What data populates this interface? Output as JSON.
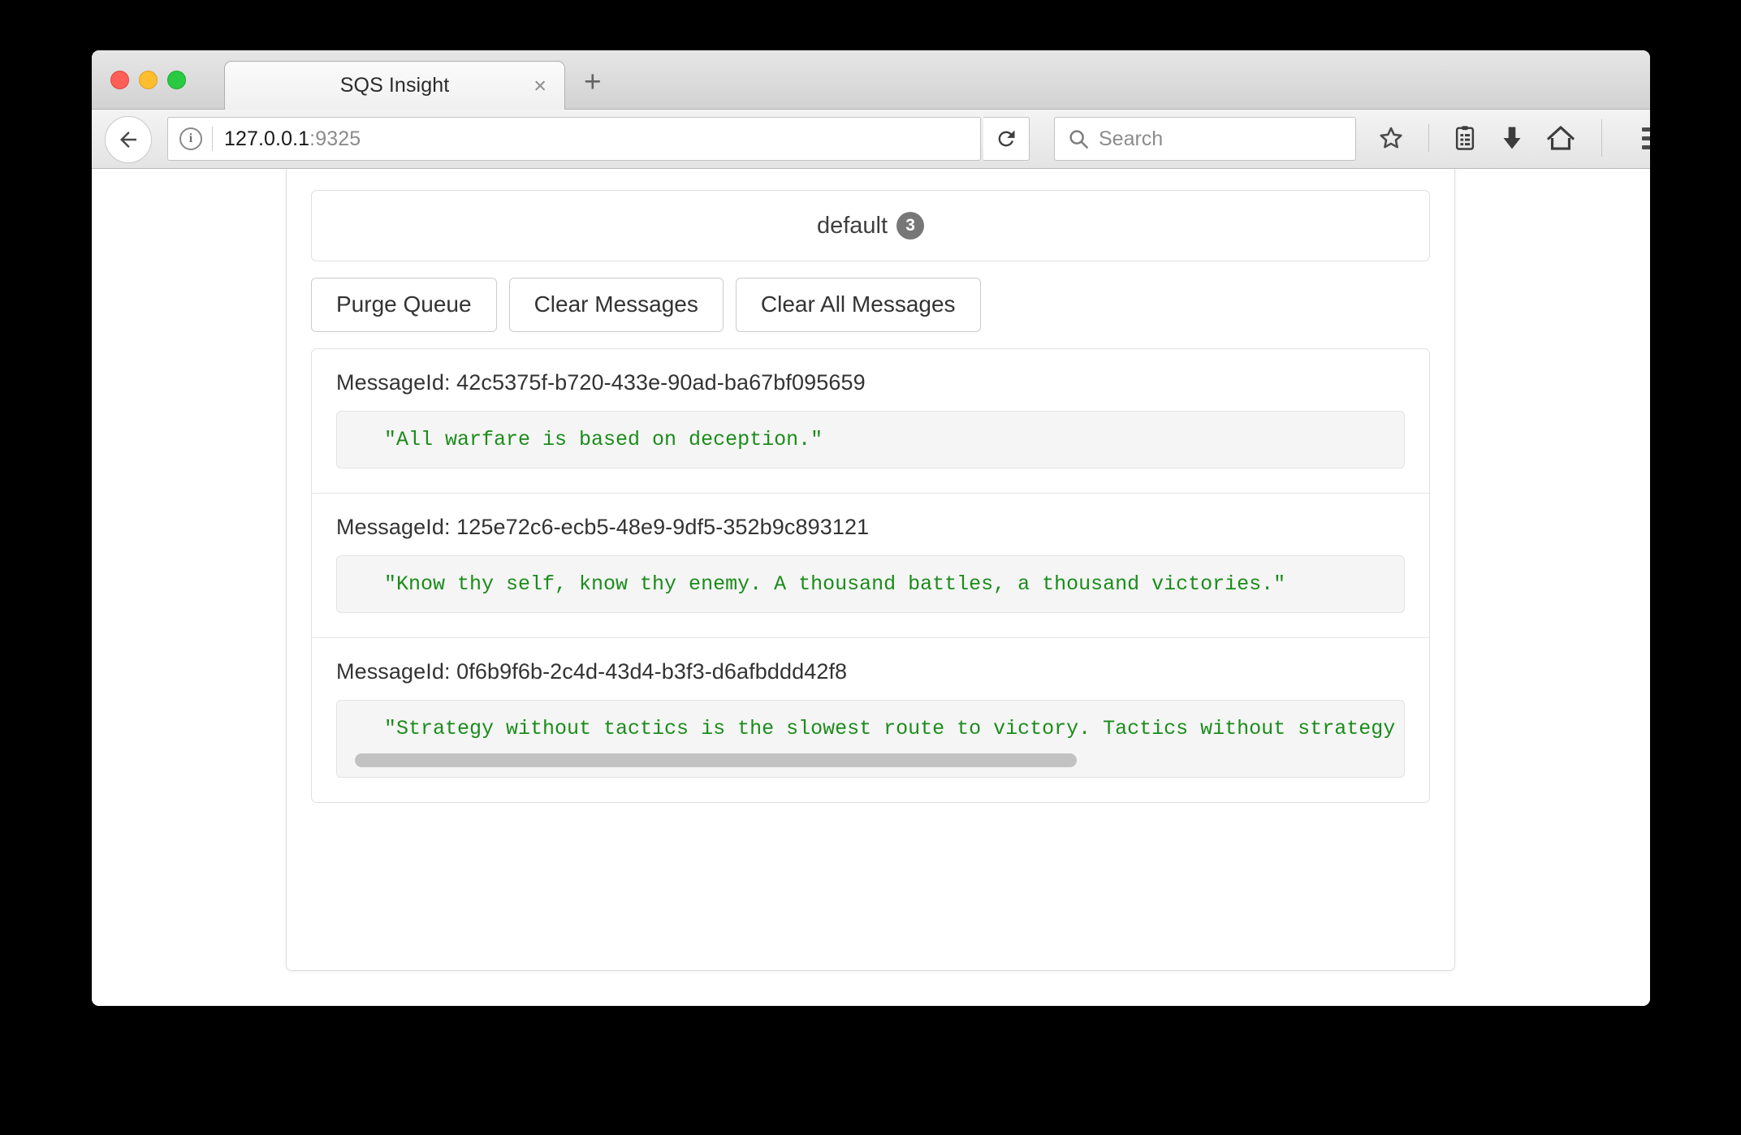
{
  "browser": {
    "tab": {
      "title": "SQS Insight",
      "close_label": "×"
    },
    "new_tab_label": "+",
    "url": {
      "host": "127.0.0.1",
      "port": ":9325"
    },
    "search": {
      "placeholder": "Search"
    },
    "icons": {
      "back": "back-arrow-icon",
      "info": "i",
      "reload": "reload-icon",
      "search": "search-icon",
      "bookmark": "star-icon",
      "reader": "reader-list-icon",
      "download": "download-arrow-icon",
      "home": "home-icon",
      "menu": "hamburger-menu-icon"
    }
  },
  "page": {
    "queue": {
      "name": "default",
      "count": "3"
    },
    "actions": [
      {
        "label": "Purge Queue",
        "name": "purge-queue-button"
      },
      {
        "label": "Clear Messages",
        "name": "clear-messages-button"
      },
      {
        "label": "Clear All Messages",
        "name": "clear-all-messages-button"
      }
    ],
    "message_id_prefix": "MessageId: ",
    "messages": [
      {
        "id_line": "MessageId: 42c5375f-b720-433e-90ad-ba67bf095659",
        "body": "\"All warfare is based on deception.\"",
        "scrollable": false
      },
      {
        "id_line": "MessageId: 125e72c6-ecb5-48e9-9df5-352b9c893121",
        "body": "\"Know thy self, know thy enemy. A thousand battles, a thousand victories.\"",
        "scrollable": false
      },
      {
        "id_line": "MessageId: 0f6b9f6b-2c4d-43d4-b3f3-d6afbddd42f8",
        "body": "\"Strategy without tactics is the slowest route to victory. Tactics without strategy is the noise before defeat.\"",
        "scrollable": true
      }
    ]
  },
  "colors": {
    "code_green": "#1a8c1a",
    "badge_gray": "#777777",
    "code_bg": "#f5f5f5"
  }
}
